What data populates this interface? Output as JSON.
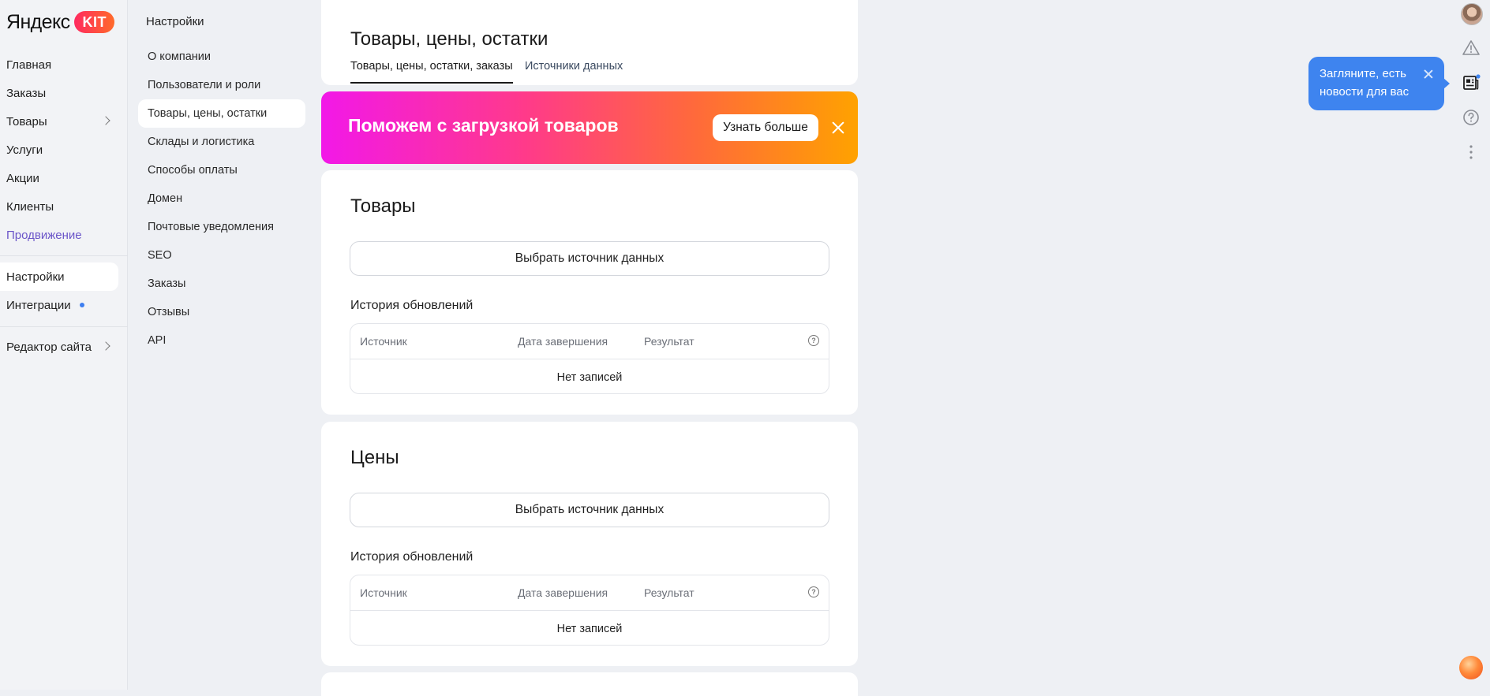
{
  "logo": {
    "text": "Яндекс",
    "badge": "KIT"
  },
  "nav": {
    "items": [
      {
        "label": "Главная"
      },
      {
        "label": "Заказы"
      },
      {
        "label": "Товары"
      },
      {
        "label": "Услуги"
      },
      {
        "label": "Акции"
      },
      {
        "label": "Клиенты"
      },
      {
        "label": "Продвижение"
      },
      {
        "label": "Настройки"
      },
      {
        "label": "Интеграции"
      },
      {
        "label": "Редактор сайта"
      }
    ]
  },
  "subnav": {
    "title": "Настройки",
    "items": [
      {
        "label": "О компании"
      },
      {
        "label": "Пользователи и роли"
      },
      {
        "label": "Товары, цены, остатки"
      },
      {
        "label": "Склады и логистика"
      },
      {
        "label": "Способы оплаты"
      },
      {
        "label": "Домен"
      },
      {
        "label": "Почтовые уведомления"
      },
      {
        "label": "SEO"
      },
      {
        "label": "Заказы"
      },
      {
        "label": "Отзывы"
      },
      {
        "label": "API"
      }
    ]
  },
  "header": {
    "title": "Товары, цены, остатки",
    "tabs": [
      {
        "label": "Товары, цены, остатки, заказы"
      },
      {
        "label": "Источники данных"
      }
    ]
  },
  "banner": {
    "text": "Поможем с загрузкой товаров",
    "button_label": "Узнать больше"
  },
  "sections": [
    {
      "title": "Товары",
      "source_button": "Выбрать источник данных",
      "history_label": "История обновлений",
      "columns": [
        "Источник",
        "Дата завершения",
        "Результат"
      ],
      "empty_text": "Нет записей"
    },
    {
      "title": "Цены",
      "source_button": "Выбрать источник данных",
      "history_label": "История обновлений",
      "columns": [
        "Источник",
        "Дата завершения",
        "Результат"
      ],
      "empty_text": "Нет записей"
    }
  ],
  "tooltip": {
    "text": "Загляните, есть новости для вас"
  },
  "icons": {
    "rail": [
      "avatar",
      "warning-icon",
      "news-icon",
      "help-icon",
      "more-vertical-icon"
    ],
    "help": "help-icon"
  },
  "colors": {
    "accent_blue": "#3e84ef",
    "promo_purple": "#6b55c9",
    "banner_gradient_start": "#f218e8",
    "banner_gradient_end": "#ffa200"
  }
}
